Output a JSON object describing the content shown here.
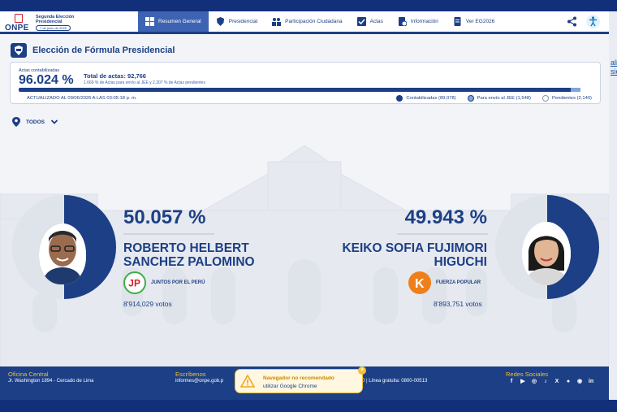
{
  "header": {
    "logo_text": "ONPE",
    "logo_title": "Segunda Elección Presidencial",
    "logo_date": "7 de junio de 2026",
    "nav": [
      {
        "label": "Resumen General",
        "icon": "grid-icon",
        "active": true
      },
      {
        "label": "Presidencial",
        "icon": "shield-icon",
        "active": false
      },
      {
        "label": "Participación Ciudadana",
        "icon": "people-icon",
        "active": false
      },
      {
        "label": "Actas",
        "icon": "checkbox-icon",
        "active": false
      },
      {
        "label": "Información",
        "icon": "info-doc-icon",
        "active": false
      },
      {
        "label": "Ver EG2026",
        "icon": "document-icon",
        "active": false
      }
    ]
  },
  "page": {
    "title": "Elección de Fórmula Presidencial"
  },
  "summary": {
    "actas_label": "Actas contabilizadas",
    "actas_pct": "96.024 %",
    "total_label": "Total de actas: 92,766",
    "total_sub": "1.669 % de Actas para envío al JEE y 2.307 % de Actas pendientes",
    "updated": "ACTUALIZADO AL 09/06/2026 A LAS 03:05:18 p. m.",
    "progress": {
      "contabilizadas": 96.024,
      "jee": 1.669,
      "pendientes": 2.307
    },
    "legend": [
      {
        "label": "Contabilizadas (89,078)",
        "color": "#1c3f86"
      },
      {
        "label": "Para envío al JEE (1,548)",
        "color": "#7fa6d8"
      },
      {
        "label": "Pendientes (2,140)",
        "color": "#ffffff"
      }
    ]
  },
  "filter": {
    "label": "TODOS"
  },
  "candidates": {
    "left": {
      "pct": "50.057 %",
      "name_line1": "ROBERTO HELBERT",
      "name_line2": "SANCHEZ PALOMINO",
      "party": "JUNTOS POR EL PERÚ",
      "votes": "8'914,029 votos",
      "share": 50.057
    },
    "right": {
      "pct": "49.943 %",
      "name_line1": "KEIKO SOFIA FUJIMORI",
      "name_line2": "HIGUCHI",
      "party": "FUERZA POPULAR",
      "votes": "8'893,751 votos",
      "share": 49.943
    }
  },
  "footer": {
    "office_head": "Oficina Central",
    "office_text": "Jr. Washington 1894 - Cercado de Lima",
    "write_head": "Escríbenos",
    "write_text": "informes@onpe.gob.p",
    "phone_text": "0 | Línea gratuita: 0800-00513",
    "social_head": "Redes Sociales"
  },
  "toast": {
    "title": "Navegador no recomendado",
    "text": "utilizar Google Chrome",
    "close": "×"
  },
  "side_link": {
    "line1": "ali",
    "line2": "sic"
  }
}
